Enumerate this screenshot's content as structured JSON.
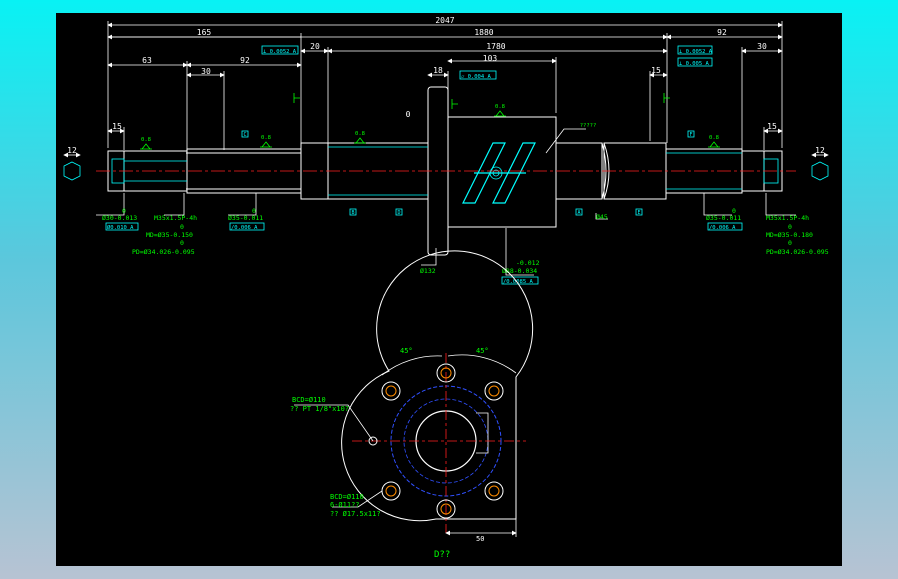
{
  "colors": {
    "dim": "#ffffff",
    "green": "#00ff00",
    "cyan": "#00ffff",
    "red": "#ff2020",
    "blue": "#3050ff",
    "yellow": "#ffff00",
    "background": "#000000"
  },
  "dims": {
    "total": "2047",
    "left_seg": "165",
    "mid_seg": "1880",
    "right_seg": "92",
    "gap20": "20",
    "len1780": "1780",
    "d63": "63",
    "d30a": "30",
    "d92a": "92",
    "d18": "18",
    "d103": "103",
    "d15a": "15",
    "d30b": "30",
    "d15b": "15",
    "d15c": "15",
    "d12a": "12",
    "d12b": "12",
    "zero_mark": "0",
    "q_mark": "?????"
  },
  "tol_boxes": {
    "b1": "⊥ 0.0052 A",
    "b2": "▱ 0.004 A",
    "b3": "⊥ 0.0052 A",
    "b4": "⊥ 0.005 A"
  },
  "datums": {
    "a": "A",
    "b": "B",
    "c": "C",
    "d": "D",
    "e": "E",
    "f": "F"
  },
  "rough": {
    "r1": "0.8",
    "r2": "0.8",
    "r3": "0.8",
    "r4": "0.8",
    "r5": "0.8",
    "r6": "0.8"
  },
  "left_notes": {
    "z1": "0",
    "dia1": "Ø30-0.013",
    "box1": "Ø0.010 A",
    "thread": "M35x1.5P-4h",
    "z2": "0",
    "md": "MD=Ø35-0.150",
    "z3": "0",
    "pd": "PD=Ø34.026-0.095",
    "z4": "0",
    "dia2": "Ø35-0.011",
    "box2": "/0.006 A"
  },
  "right_notes": {
    "z1": "0",
    "dia1": "Ø35-0.011",
    "box1": "/0.006 A",
    "thread": "M35x1.5P-4h",
    "z2": "0",
    "md": "MD=Ø35-0.180",
    "z3": "0",
    "pd": "PD=Ø34.026-0.095"
  },
  "mid_notes": {
    "d132": "Ø132",
    "tolA": "-0.012",
    "d88": "Ø88-0.034",
    "boxA": "/0.0085 A",
    "d45": "Ø45"
  },
  "end_view": {
    "ang1": "45°",
    "ang2": "45°",
    "bcd1": "BCD=Ø110",
    "pt": "?? PT 1/8\"x10?",
    "bcd2": "BCD=Ø110",
    "holes": "6-Ø11??",
    "cbore": "?? Ø17.5x11?",
    "dim50": "50",
    "title": "D??"
  }
}
